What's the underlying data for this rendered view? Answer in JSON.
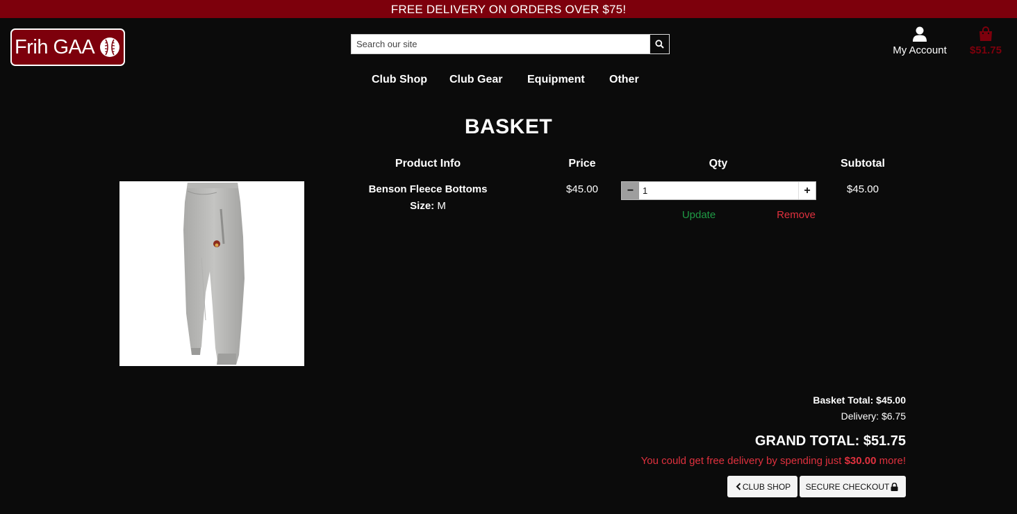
{
  "banner": {
    "text": "FREE DELIVERY ON ORDERS OVER $75!"
  },
  "logo": {
    "text": "Frih GAA",
    "icon": "sliotar-ball-icon"
  },
  "search": {
    "placeholder": "Search our site",
    "value": "",
    "icon": "search-icon"
  },
  "account": {
    "label": "My Account",
    "icon": "user-icon"
  },
  "cart": {
    "total": "$51.75",
    "icon": "shopping-bag-icon"
  },
  "nav": {
    "items": [
      {
        "label": "Club Shop"
      },
      {
        "label": "Club Gear"
      },
      {
        "label": "Equipment"
      },
      {
        "label": "Other"
      }
    ]
  },
  "page": {
    "title": "BASKET"
  },
  "table": {
    "headers": [
      "Product Info",
      "Price",
      "Qty",
      "Subtotal"
    ],
    "rows": [
      {
        "name": "Benson Fleece Bottoms",
        "size_label": "Size:",
        "size": "M",
        "price": "$45.00",
        "qty": "1",
        "subtotal": "$45.00",
        "update_label": "Update",
        "remove_label": "Remove",
        "minus_symbol": "−",
        "plus_symbol": "+"
      }
    ]
  },
  "summary": {
    "basket_total": "Basket Total: $45.00",
    "delivery": "Delivery: $6.75",
    "grand_total": "GRAND TOTAL: $51.75",
    "notice_prefix": "You could get free delivery by spending just ",
    "notice_amount": "$30.00",
    "notice_suffix": " more!"
  },
  "buttons": {
    "club_shop": "CLUB SHOP",
    "checkout": "SECURE CHECKOUT"
  },
  "colors": {
    "brand": "#7d000c",
    "background": "#0b0b0b",
    "update": "#1f9a45",
    "remove": "#e0313e"
  }
}
